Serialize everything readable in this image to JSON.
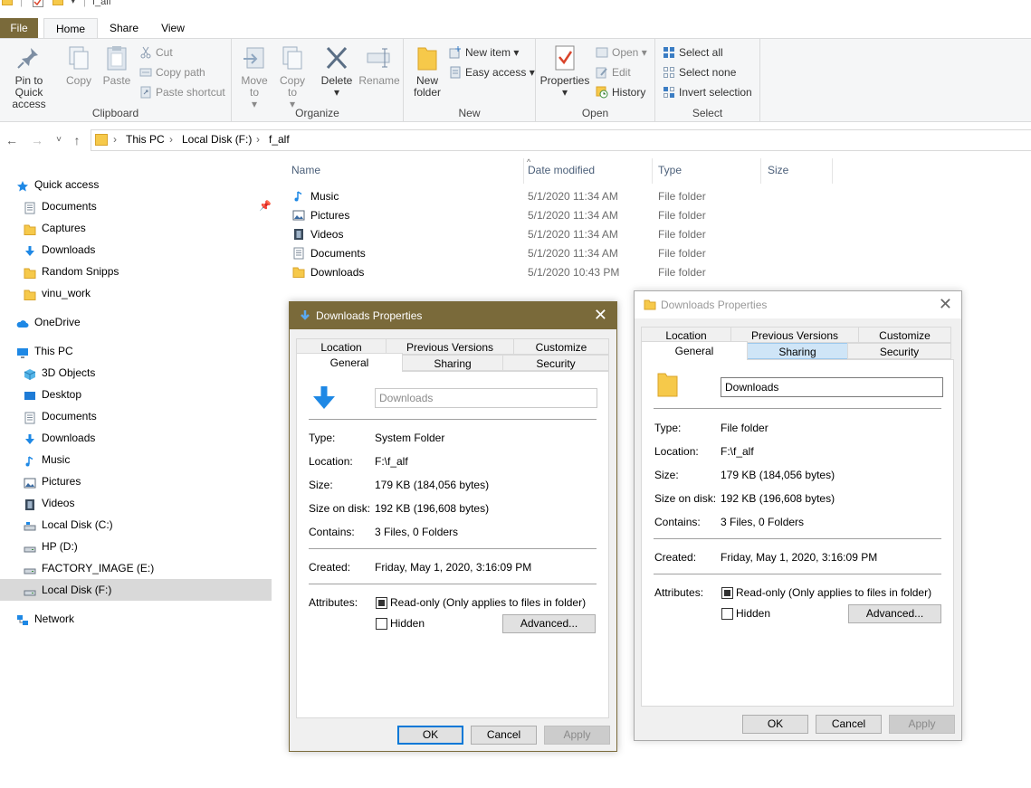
{
  "titlebar": {
    "path": "f_alf"
  },
  "ribbon_tabs": [
    "File",
    "Home",
    "Share",
    "View"
  ],
  "ribbon": {
    "clipboard": {
      "label": "Clipboard",
      "pin": "Pin to Quick access",
      "copy": "Copy",
      "paste": "Paste",
      "cut": "Cut",
      "copy_path": "Copy path",
      "paste_shortcut": "Paste shortcut"
    },
    "organize": {
      "label": "Organize",
      "move_to": "Move to",
      "copy_to": "Copy to",
      "delete": "Delete",
      "rename": "Rename"
    },
    "new": {
      "label": "New",
      "new_folder": "New folder",
      "new_item": "New item",
      "easy_access": "Easy access"
    },
    "open": {
      "label": "Open",
      "properties": "Properties",
      "open": "Open",
      "edit": "Edit",
      "history": "History"
    },
    "select": {
      "label": "Select",
      "select_all": "Select all",
      "select_none": "Select none",
      "invert": "Invert selection"
    }
  },
  "address": {
    "crumbs": [
      "This PC",
      "Local Disk (F:)",
      "f_alf"
    ]
  },
  "sidebar": {
    "items": [
      {
        "label": "Quick access",
        "icon": "star-icon",
        "level": 0
      },
      {
        "label": "Documents",
        "icon": "documents-icon",
        "level": 1
      },
      {
        "label": "Captures",
        "icon": "folder-icon",
        "level": 1
      },
      {
        "label": "Downloads",
        "icon": "downloads-icon",
        "level": 1
      },
      {
        "label": "Random Snipps",
        "icon": "folder-icon",
        "level": 1
      },
      {
        "label": "vinu_work",
        "icon": "folder-icon",
        "level": 1
      },
      {
        "label": "OneDrive",
        "icon": "cloud-icon",
        "level": 0
      },
      {
        "label": "This PC",
        "icon": "pc-icon",
        "level": 0
      },
      {
        "label": "3D Objects",
        "icon": "cube-icon",
        "level": 1
      },
      {
        "label": "Desktop",
        "icon": "desktop-icon",
        "level": 1
      },
      {
        "label": "Documents",
        "icon": "documents-icon",
        "level": 1
      },
      {
        "label": "Downloads",
        "icon": "downloads-icon",
        "level": 1
      },
      {
        "label": "Music",
        "icon": "music-icon",
        "level": 1
      },
      {
        "label": "Pictures",
        "icon": "pictures-icon",
        "level": 1
      },
      {
        "label": "Videos",
        "icon": "videos-icon",
        "level": 1
      },
      {
        "label": "Local Disk (C:)",
        "icon": "drive-c-icon",
        "level": 1
      },
      {
        "label": "HP (D:)",
        "icon": "drive-icon",
        "level": 1
      },
      {
        "label": "FACTORY_IMAGE (E:)",
        "icon": "drive-icon",
        "level": 1
      },
      {
        "label": "Local Disk (F:)",
        "icon": "drive-icon",
        "level": 1,
        "selected": true
      },
      {
        "label": "Network",
        "icon": "network-icon",
        "level": 0
      }
    ]
  },
  "filelist": {
    "columns": [
      "Name",
      "Date modified",
      "Type",
      "Size"
    ],
    "rows": [
      {
        "name": "Music",
        "date": "5/1/2020 11:34 AM",
        "type": "File folder",
        "size": "",
        "icon": "music-icon"
      },
      {
        "name": "Pictures",
        "date": "5/1/2020 11:34 AM",
        "type": "File folder",
        "size": "",
        "icon": "pictures-icon"
      },
      {
        "name": "Videos",
        "date": "5/1/2020 11:34 AM",
        "type": "File folder",
        "size": "",
        "icon": "videos-icon"
      },
      {
        "name": "Documents",
        "date": "5/1/2020 11:34 AM",
        "type": "File folder",
        "size": "",
        "icon": "documents-icon"
      },
      {
        "name": "Downloads",
        "date": "5/1/2020 10:43 PM",
        "type": "File folder",
        "size": "",
        "icon": "folder-icon"
      }
    ]
  },
  "dialog1": {
    "title": "Downloads Properties",
    "tabs_top": [
      "Location",
      "Previous Versions",
      "Customize"
    ],
    "tabs_bottom": [
      "General",
      "Sharing",
      "Security"
    ],
    "name_value": "Downloads",
    "type_label": "Type:",
    "type_value": "System Folder",
    "location_label": "Location:",
    "location_value": "F:\\f_alf",
    "size_label": "Size:",
    "size_value": "179 KB (184,056 bytes)",
    "sod_label": "Size on disk:",
    "sod_value": "192 KB (196,608 bytes)",
    "contains_label": "Contains:",
    "contains_value": "3 Files, 0 Folders",
    "created_label": "Created:",
    "created_value": "Friday, May 1, 2020, 3:16:09 PM",
    "attributes_label": "Attributes:",
    "readonly": "Read-only (Only applies to files in folder)",
    "hidden": "Hidden",
    "advanced": "Advanced...",
    "ok": "OK",
    "cancel": "Cancel",
    "apply": "Apply"
  },
  "dialog2": {
    "title": "Downloads Properties",
    "tabs_top": [
      "Location",
      "Previous Versions",
      "Customize"
    ],
    "tabs_bottom": [
      "General",
      "Sharing",
      "Security"
    ],
    "name_value": "Downloads",
    "type_label": "Type:",
    "type_value": "File folder",
    "location_label": "Location:",
    "location_value": "F:\\f_alf",
    "size_label": "Size:",
    "size_value": "179 KB (184,056 bytes)",
    "sod_label": "Size on disk:",
    "sod_value": "192 KB (196,608 bytes)",
    "contains_label": "Contains:",
    "contains_value": "3 Files, 0 Folders",
    "created_label": "Created:",
    "created_value": "Friday, May 1, 2020, 3:16:09 PM",
    "attributes_label": "Attributes:",
    "readonly": "Read-only (Only applies to files in folder)",
    "hidden": "Hidden",
    "advanced": "Advanced...",
    "ok": "OK",
    "cancel": "Cancel",
    "apply": "Apply"
  },
  "colors": {
    "accent": "#7a6a3a",
    "folder": "#f6c94a",
    "blue": "#1e88e5",
    "header_text": "#4c607a"
  }
}
